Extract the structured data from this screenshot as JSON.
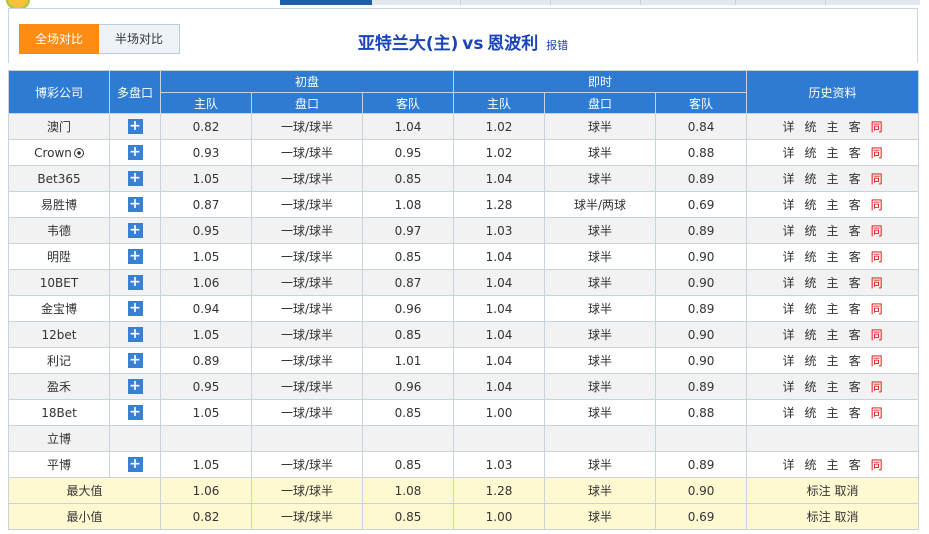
{
  "tabs": {
    "full": "全场对比",
    "half": "半场对比"
  },
  "match": {
    "home": "亚特兰大(主)",
    "vs": "vs",
    "away": "恩波利",
    "report": "报错"
  },
  "headers": {
    "company": "博彩公司",
    "multi": "多盘口",
    "initial": "初盘",
    "live": "即时",
    "history": "历史资料",
    "home": "主队",
    "line": "盘口",
    "away": "客队"
  },
  "history_labels": {
    "detail": "详",
    "stats": "统",
    "home": "主",
    "away": "客",
    "same": "同"
  },
  "rows": [
    {
      "company": "澳门",
      "multi": true,
      "i_home": "0.82",
      "i_line": "一球/球半",
      "i_away": "1.04",
      "l_home": "1.02",
      "l_line": "球半",
      "l_away": "0.84",
      "hist": true
    },
    {
      "company": "Crown",
      "multi": true,
      "i_home": "0.93",
      "i_line": "一球/球半",
      "i_away": "0.95",
      "l_home": "1.02",
      "l_line": "球半",
      "l_away": "0.88",
      "hist": true
    },
    {
      "company": "Bet365",
      "multi": true,
      "i_home": "1.05",
      "i_line": "一球/球半",
      "i_away": "0.85",
      "l_home": "1.04",
      "l_line": "球半",
      "l_away": "0.89",
      "hist": true
    },
    {
      "company": "易胜博",
      "multi": true,
      "i_home": "0.87",
      "i_line": "一球/球半",
      "i_away": "1.08",
      "l_home": "1.28",
      "l_line": "球半/两球",
      "l_away": "0.69",
      "hist": true
    },
    {
      "company": "韦德",
      "multi": true,
      "i_home": "0.95",
      "i_line": "一球/球半",
      "i_away": "0.97",
      "l_home": "1.03",
      "l_line": "球半",
      "l_away": "0.89",
      "hist": true
    },
    {
      "company": "明陞",
      "multi": true,
      "i_home": "1.05",
      "i_line": "一球/球半",
      "i_away": "0.85",
      "l_home": "1.04",
      "l_line": "球半",
      "l_away": "0.90",
      "hist": true
    },
    {
      "company": "10BET",
      "multi": true,
      "i_home": "1.06",
      "i_line": "一球/球半",
      "i_away": "0.87",
      "l_home": "1.04",
      "l_line": "球半",
      "l_away": "0.90",
      "hist": true
    },
    {
      "company": "金宝博",
      "multi": true,
      "i_home": "0.94",
      "i_line": "一球/球半",
      "i_away": "0.96",
      "l_home": "1.04",
      "l_line": "球半",
      "l_away": "0.89",
      "hist": true
    },
    {
      "company": "12bet",
      "multi": true,
      "i_home": "1.05",
      "i_line": "一球/球半",
      "i_away": "0.85",
      "l_home": "1.04",
      "l_line": "球半",
      "l_away": "0.90",
      "hist": true
    },
    {
      "company": "利记",
      "multi": true,
      "i_home": "0.89",
      "i_line": "一球/球半",
      "i_away": "1.01",
      "l_home": "1.04",
      "l_line": "球半",
      "l_away": "0.90",
      "hist": true
    },
    {
      "company": "盈禾",
      "multi": true,
      "i_home": "0.95",
      "i_line": "一球/球半",
      "i_away": "0.96",
      "l_home": "1.04",
      "l_line": "球半",
      "l_away": "0.89",
      "hist": true
    },
    {
      "company": "18Bet",
      "multi": true,
      "i_home": "1.05",
      "i_line": "一球/球半",
      "i_away": "0.85",
      "l_home": "1.00",
      "l_line": "球半",
      "l_away": "0.88",
      "hist": true
    },
    {
      "company": "立博",
      "multi": false,
      "i_home": "",
      "i_line": "",
      "i_away": "",
      "l_home": "",
      "l_line": "",
      "l_away": "",
      "hist": false
    },
    {
      "company": "平博",
      "multi": true,
      "i_home": "1.05",
      "i_line": "一球/球半",
      "i_away": "0.85",
      "l_home": "1.03",
      "l_line": "球半",
      "l_away": "0.89",
      "hist": true
    }
  ],
  "summary": [
    {
      "label": "最大值",
      "i_home": "1.06",
      "i_line": "一球/球半",
      "i_away": "1.08",
      "l_home": "1.28",
      "l_line": "球半",
      "l_away": "0.90",
      "action1": "标注",
      "action2": "取消"
    },
    {
      "label": "最小值",
      "i_home": "0.82",
      "i_line": "一球/球半",
      "i_away": "0.85",
      "l_home": "1.00",
      "l_line": "球半",
      "l_away": "0.69",
      "action1": "标注",
      "action2": "取消"
    }
  ]
}
